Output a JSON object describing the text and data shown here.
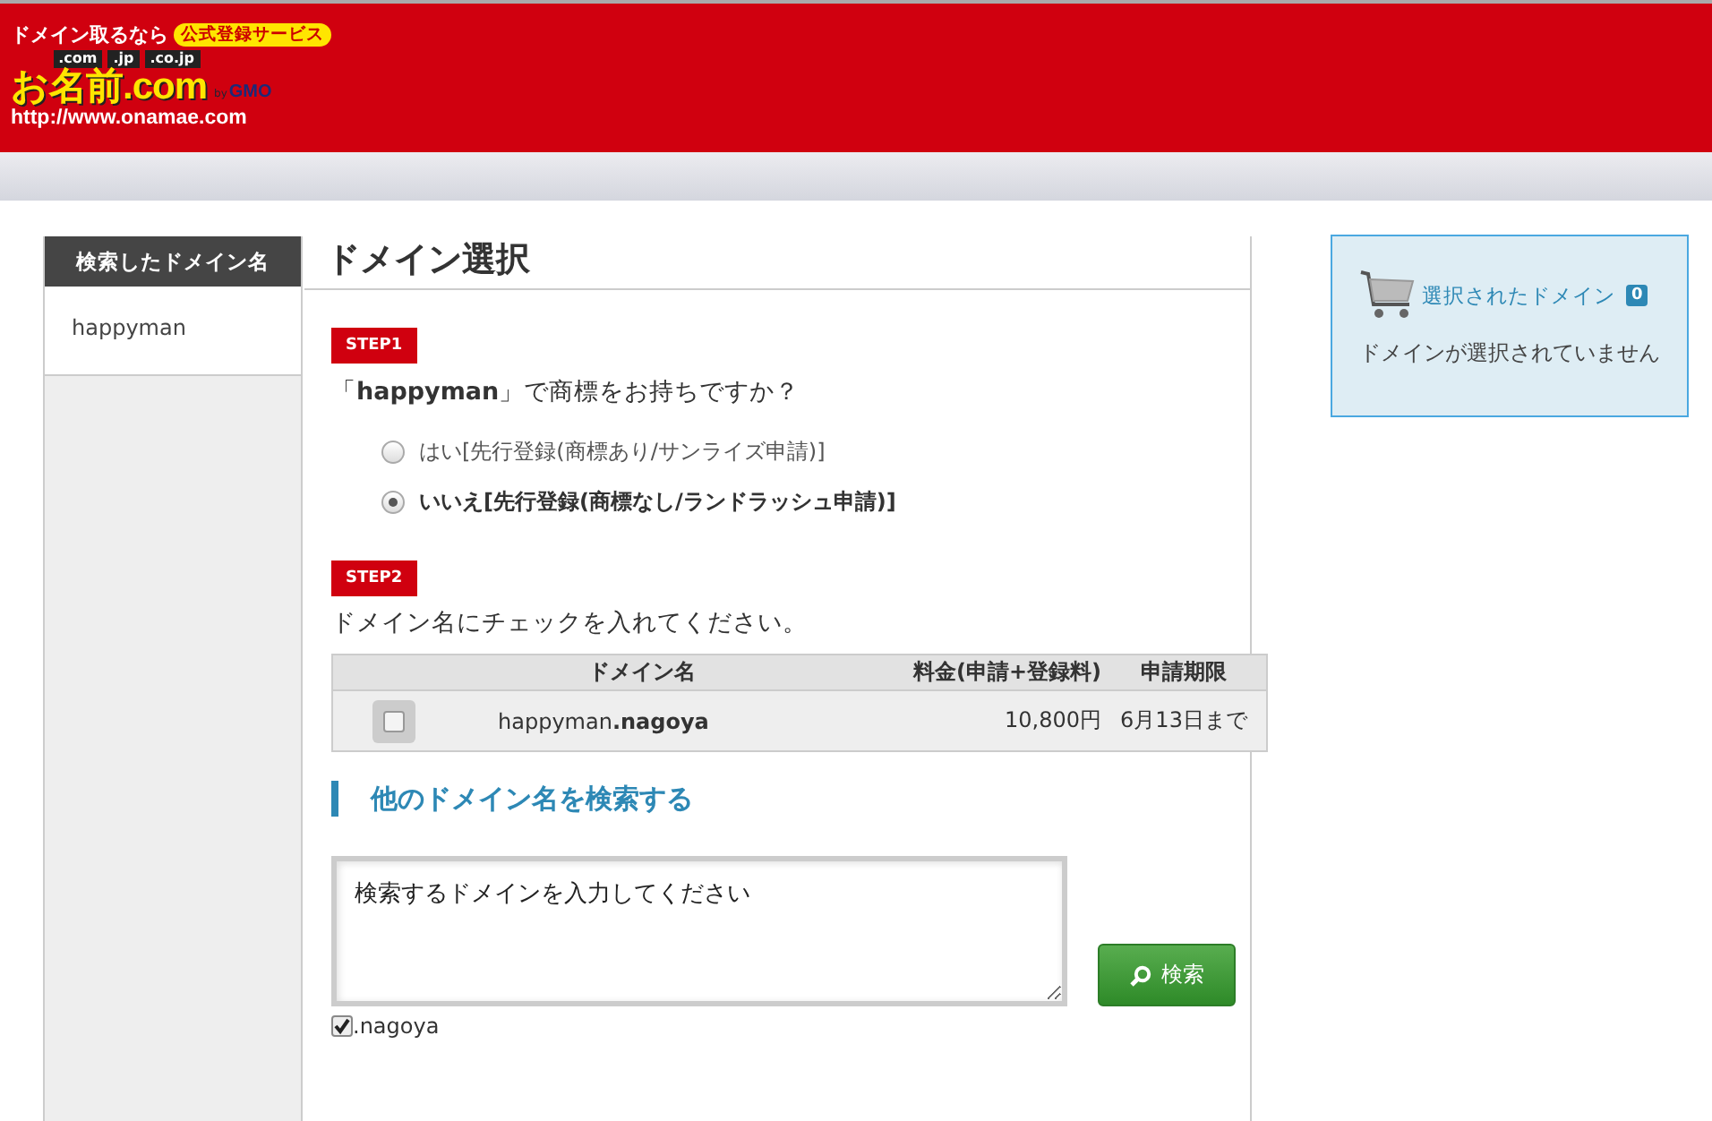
{
  "logo": {
    "tagline": "ドメイン取るなら",
    "badge": "公式登録サービス",
    "tlds": [
      ".com",
      ".jp",
      ".co.jp"
    ],
    "name": "お名前.com",
    "url": "http://www.onamae.com",
    "by": "by",
    "gmo": "GMO"
  },
  "sidebar": {
    "title": "検索したドメイン名",
    "items": [
      {
        "label": "happyman",
        "selected": true
      }
    ]
  },
  "main": {
    "title": "ドメイン選択",
    "step1": {
      "badge": "STEP1",
      "question": "「**happyman**」で商標をお持ちですか？",
      "options": [
        {
          "label": "はい[先行登録(商標あり/サンライズ申請)]",
          "selected": false
        },
        {
          "label": "いいえ[先行登録(商標なし/ランドラッシュ申請)]",
          "selected": true
        }
      ]
    },
    "step2": {
      "badge": "STEP2",
      "instruction": "ドメイン名にチェックを入れてください。",
      "table": {
        "columns": [
          "ドメイン名",
          "料金(申請+登録料)",
          "申請期限"
        ],
        "rows": [
          {
            "checked": false,
            "domain": "happyman**.nagoya**",
            "price": "10,800円",
            "deadline": "6月13日まで"
          }
        ]
      }
    },
    "search": {
      "heading": "他のドメイン名を検索する",
      "placeholder": "検索するドメインを入力してください",
      "button": "検索",
      "tlds": [
        {
          "label": ".nagoya",
          "checked": true
        }
      ]
    }
  },
  "cart": {
    "title": "選択されたドメイン",
    "count": "0",
    "empty": "ドメインが選択されていません"
  }
}
